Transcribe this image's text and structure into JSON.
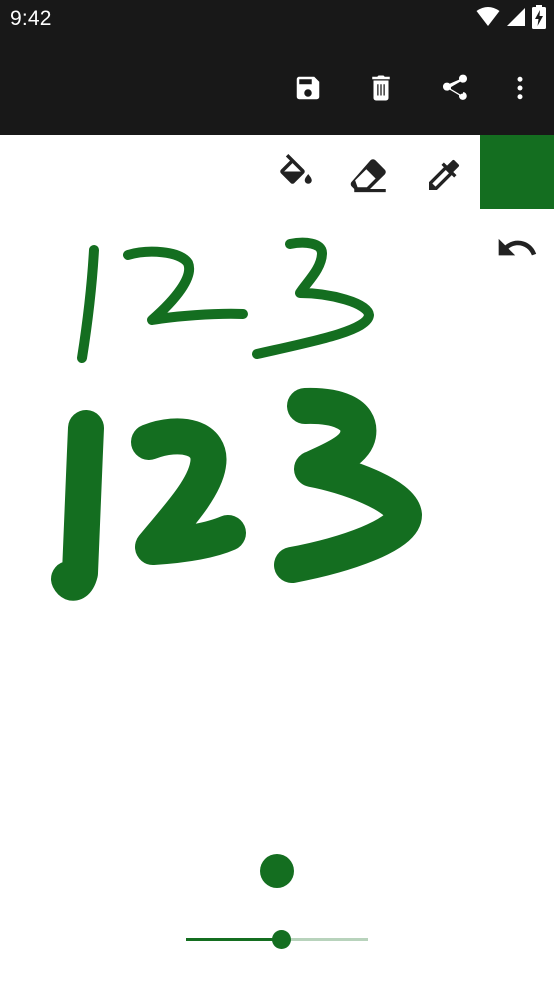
{
  "status_bar": {
    "time": "9:42",
    "icons": [
      "wifi-icon",
      "signal-icon",
      "battery-charging-icon"
    ]
  },
  "toolbar": {
    "actions": [
      "save-icon",
      "delete-icon",
      "share-icon",
      "more-vert-icon"
    ]
  },
  "tools": {
    "items": [
      "paint-bucket-icon",
      "eraser-icon",
      "eyedropper-icon"
    ],
    "undo_icon": "undo-icon"
  },
  "colors": {
    "brush": "#146e20",
    "bar": "#181818"
  },
  "brush": {
    "size_fraction": 0.52
  }
}
